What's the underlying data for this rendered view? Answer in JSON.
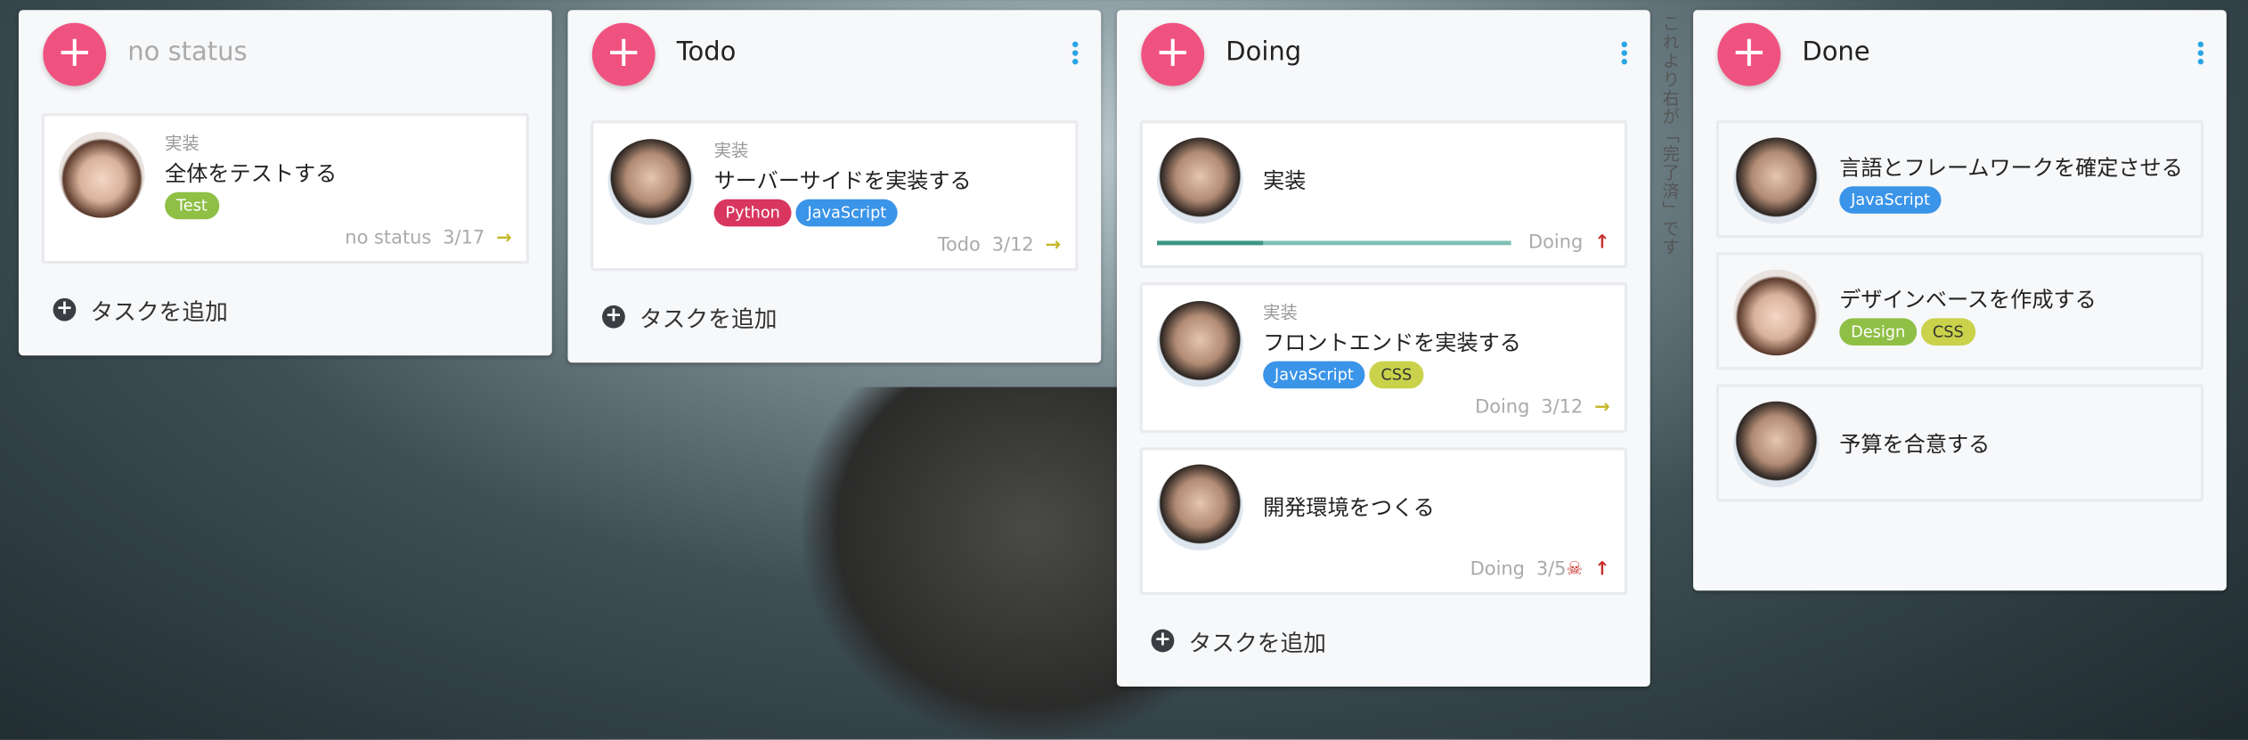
{
  "note": "これより右が「完了済」です",
  "add_task_label": "タスクを追加",
  "colors": {
    "accent": "#f0527f",
    "python": "#d8365f",
    "javascript": "#3a94e8",
    "test": "#8fbf45",
    "design": "#8fbf45",
    "css": "#c9d24a",
    "kebab": "#2aa5e6"
  },
  "columns": [
    {
      "title": "no status",
      "cards": [
        {
          "label": "実装",
          "title": "全体をテストする",
          "tags": [
            "Test"
          ],
          "status": "no status",
          "date": "3/17"
        }
      ]
    },
    {
      "title": "Todo",
      "cards": [
        {
          "label": "実装",
          "title": "サーバーサイドを実装する",
          "tags": [
            "Python",
            "JavaScript"
          ],
          "status": "Todo",
          "date": "3/12"
        }
      ]
    },
    {
      "title": "Doing",
      "cards": [
        {
          "title": "実装",
          "status": "Doing",
          "progress": 0.3
        },
        {
          "label": "実装",
          "title": "フロントエンドを実装する",
          "tags": [
            "JavaScript",
            "CSS"
          ],
          "status": "Doing",
          "date": "3/12"
        },
        {
          "title": "開発環境をつくる",
          "status": "Doing",
          "date": "3/5"
        }
      ]
    },
    {
      "title": "Done",
      "cards": [
        {
          "title": "言語とフレームワークを確定させる",
          "tags": [
            "JavaScript"
          ]
        },
        {
          "title": "デザインベースを作成する",
          "tags": [
            "Design",
            "CSS"
          ]
        },
        {
          "title": "予算を合意する"
        }
      ]
    }
  ]
}
